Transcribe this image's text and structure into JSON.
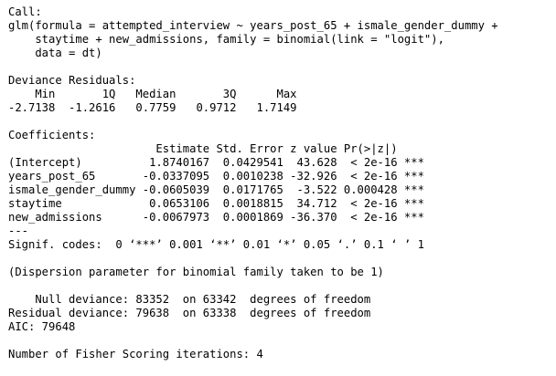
{
  "console": {
    "lines": [
      "Call:",
      "glm(formula = attempted_interview ~ years_post_65 + ismale_gender_dummy +",
      "    staytime + new_admissions, family = binomial(link = \"logit\"),",
      "    data = dt)",
      "",
      "Deviance Residuals:",
      "    Min       1Q   Median       3Q      Max",
      "-2.7138  -1.2616   0.7759   0.9712   1.7149",
      "",
      "Coefficients:",
      "                      Estimate Std. Error z value Pr(>|z|)",
      "(Intercept)          1.8740167  0.0429541  43.628  < 2e-16 ***",
      "years_post_65       -0.0337095  0.0010238 -32.926  < 2e-16 ***",
      "ismale_gender_dummy -0.0605039  0.0171765  -3.522 0.000428 ***",
      "staytime             0.0653106  0.0018815  34.712  < 2e-16 ***",
      "new_admissions      -0.0067973  0.0001869 -36.370  < 2e-16 ***",
      "---",
      "Signif. codes:  0 ‘***’ 0.001 ‘**’ 0.01 ‘*’ 0.05 ‘.’ 0.1 ‘ ’ 1",
      "",
      "(Dispersion parameter for binomial family taken to be 1)",
      "",
      "    Null deviance: 83352  on 63342  degrees of freedom",
      "Residual deviance: 79638  on 63338  degrees of freedom",
      "AIC: 79648",
      "",
      "Number of Fisher Scoring iterations: 4"
    ]
  }
}
